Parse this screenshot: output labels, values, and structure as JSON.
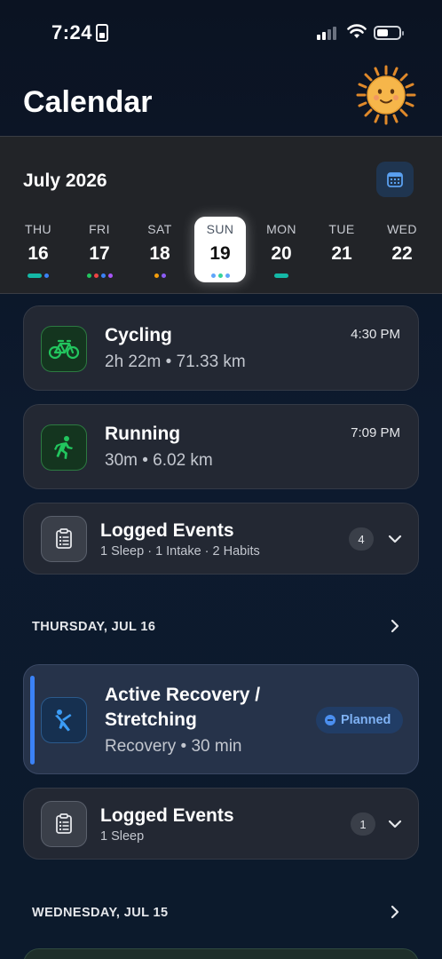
{
  "status_bar": {
    "time": "7:24"
  },
  "header": {
    "title": "Calendar"
  },
  "week": {
    "month": "July 2026",
    "days": [
      {
        "dow": "THU",
        "num": "16"
      },
      {
        "dow": "FRI",
        "num": "17"
      },
      {
        "dow": "SAT",
        "num": "18"
      },
      {
        "dow": "SUN",
        "num": "19"
      },
      {
        "dow": "MON",
        "num": "20"
      },
      {
        "dow": "TUE",
        "num": "21"
      },
      {
        "dow": "WED",
        "num": "22"
      }
    ],
    "selected": "19"
  },
  "today_events": [
    {
      "title": "Cycling",
      "subtitle": "2h 22m • 71.33 km",
      "time": "4:30 PM",
      "icon": "bicycle-icon"
    },
    {
      "title": "Running",
      "subtitle": "30m • 6.02 km",
      "time": "7:09 PM",
      "icon": "running-icon"
    }
  ],
  "logged_today": {
    "title": "Logged Events",
    "summary": "1 Sleep · 1 Intake · 2 Habits",
    "count": "4",
    "icon": "clipboard-icon"
  },
  "thursday": {
    "header": "THURSDAY, JUL 16",
    "planned": {
      "title_line1": "Active Recovery /",
      "title_line2": "Stretching",
      "subtitle": "Recovery • 30 min",
      "badge": "Planned",
      "icon": "stretching-icon"
    },
    "logged": {
      "title": "Logged Events",
      "summary": "1 Sleep",
      "count": "1",
      "icon": "clipboard-icon"
    }
  },
  "wednesday": {
    "header": "WEDNESDAY, JUL 15"
  },
  "colors": {
    "accent_blue": "#3b82f6",
    "green": "#22c55e",
    "planned_text": "#7fb2f5"
  }
}
